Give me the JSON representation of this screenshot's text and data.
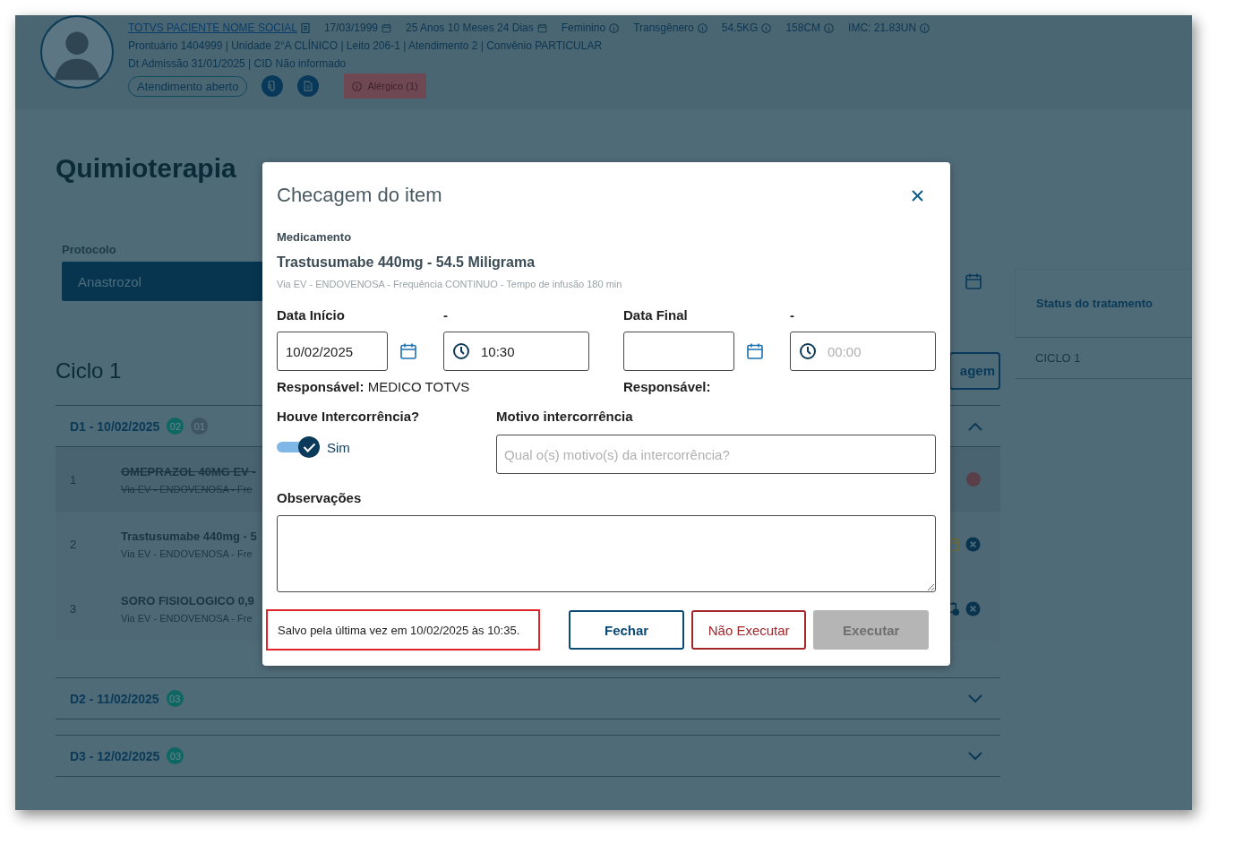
{
  "patient": {
    "name": "TOTVS PACIENTE NOME SOCIAL",
    "birth_date": "17/03/1999",
    "age": "25 Anos 10 Meses 24 Dias",
    "info": [
      "Feminino",
      "Transgênero",
      "54.5KG",
      "158CM",
      "IMC: 21.83UN"
    ],
    "details": "Prontuário 1404999  |  Unidade 2°A CLÍNICO  |  Leito 206-1  |  Atendimento 2  |  Convênio PARTICULAR",
    "admission": "Dt Admissão 31/01/2025  |  CID Não informado",
    "status": "Atendimento aberto",
    "allergy": "Alérgico (1)"
  },
  "page": {
    "title": "Quimioterapia",
    "protocol": {
      "label": "Protocolo",
      "value": "Anastrozol"
    },
    "cycle_title": "Ciclo 1",
    "partial_button": "agem",
    "days": [
      {
        "label": "D1 - 10/02/2025",
        "expanded": true,
        "badges": [
          {
            "text": "02",
            "color": "#0e6763"
          },
          {
            "text": "01",
            "color": "#3e5662"
          }
        ],
        "items": [
          {
            "number": "1",
            "name": "OMEPRAZOL 40MG EV -",
            "route": "Via EV - ENDOVENOSA - Fre",
            "struck": true,
            "actions": [
              {
                "kind": "status"
              }
            ]
          },
          {
            "number": "2",
            "name": "Trastusumabe 440mg - 5",
            "route": "Via EV - ENDOVENOSA - Fre",
            "struck": false,
            "actions": [
              {
                "kind": "edit"
              },
              {
                "kind": "cancel"
              }
            ]
          },
          {
            "number": "3",
            "name": "SORO FISIOLOGICO 0,9",
            "route": "Via EV - ENDOVENOSA - Fre",
            "struck": false,
            "actions": [
              {
                "kind": "settings"
              },
              {
                "kind": "cancel"
              }
            ]
          }
        ]
      },
      {
        "label": "D2 - 11/02/2025",
        "expanded": false,
        "badges": [
          {
            "text": "03",
            "color": "#0e6763"
          }
        ]
      },
      {
        "label": "D3 - 12/02/2025",
        "expanded": false,
        "badges": [
          {
            "text": "03",
            "color": "#0e6763"
          }
        ]
      }
    ]
  },
  "side_panel": {
    "title": "Status do tratamento",
    "items": [
      "CICLO 1"
    ]
  },
  "dialog": {
    "title": "Checagem do item",
    "medication_label": "Medicamento",
    "medication": "Trastusumabe 440mg - 54.5 Miligrama",
    "medication_details": "Via EV - ENDOVENOSA - Frequência CONTINUO - Tempo de infusão 180 min",
    "start": {
      "date_label": "Data Início",
      "time_label": "-",
      "date": "10/02/2025",
      "time": "10:30",
      "responsible_label": "Responsável:",
      "responsible": "MEDICO TOTVS"
    },
    "end": {
      "date_label": "Data Final",
      "time_label": "-",
      "time_placeholder": "00:00",
      "responsible_label": "Responsável:"
    },
    "incident": {
      "label": "Houve Intercorrência?",
      "on": true,
      "toggle_label": "Sim"
    },
    "reason": {
      "label": "Motivo intercorrência",
      "placeholder": "Qual o(s) motivo(s) da intercorrência?"
    },
    "notes": {
      "label": "Observações"
    },
    "saved_message": "Salvo pela última vez em 10/02/2025 às 10:35.",
    "buttons": [
      {
        "label": "Fechar",
        "kind": "secondary",
        "disabled": false
      },
      {
        "label": "Não Executar",
        "kind": "danger",
        "disabled": false
      },
      {
        "label": "Executar",
        "kind": "primary",
        "disabled": true
      }
    ]
  }
}
